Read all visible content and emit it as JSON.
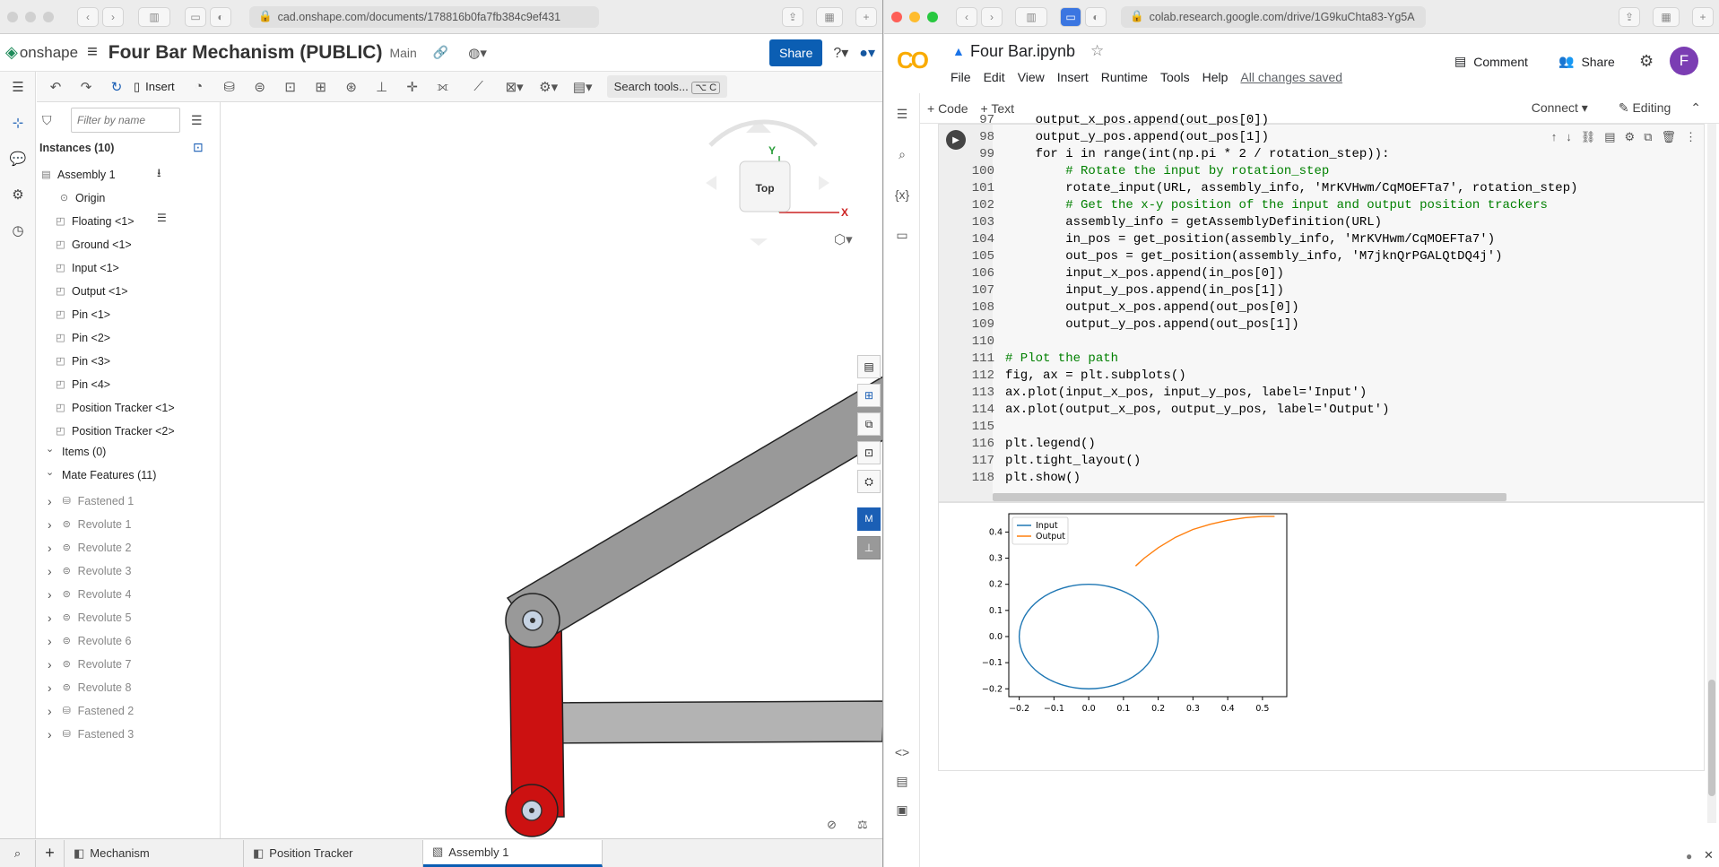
{
  "onshape": {
    "url": "cad.onshape.com/documents/178816b0fa7fb384c9ef431",
    "logo": "onshape",
    "doc_title": "Four Bar Mechanism (PUBLIC)",
    "branch": "Main",
    "share_label": "Share",
    "insert_label": "Insert",
    "search_tools": "Search tools...",
    "search_shortcut": "⌥ C",
    "filter_placeholder": "Filter by name",
    "instances_header": "Instances (10)",
    "tree": [
      "Assembly 1",
      "Origin",
      "Floating <1>",
      "Ground <1>",
      "Input <1>",
      "Output <1>",
      "Pin <1>",
      "Pin <2>",
      "Pin <3>",
      "Pin <4>",
      "Position Tracker <1>",
      "Position Tracker <2>"
    ],
    "items_header": "Items (0)",
    "mate_header": "Mate Features (11)",
    "mates": [
      "Fastened 1",
      "Revolute 1",
      "Revolute 2",
      "Revolute 3",
      "Revolute 4",
      "Revolute 5",
      "Revolute 6",
      "Revolute 7",
      "Revolute 8",
      "Fastened 2",
      "Fastened 3"
    ],
    "view_cube": "Top",
    "axis_x": "X",
    "axis_y": "Y",
    "tabs": [
      "Mechanism",
      "Position Tracker",
      "Assembly 1"
    ],
    "colors": {
      "brand": "#0b5eb3",
      "ground": "#b3b3b3",
      "input": "#cc1111",
      "coupler": "#999999",
      "output": "#3a60b0"
    }
  },
  "colab": {
    "url": "colab.research.google.com/drive/1G9kuChta83-Yg5A",
    "logo": "CO",
    "title": "Four Bar.ipynb",
    "menus": [
      "File",
      "Edit",
      "View",
      "Insert",
      "Runtime",
      "Tools",
      "Help"
    ],
    "saved": "All changes saved",
    "comment": "Comment",
    "share": "Share",
    "avatar": "F",
    "code_btn": "+ Code",
    "text_btn": "+ Text",
    "connect": "Connect",
    "editing": "Editing",
    "code": [
      {
        "n": "97",
        "t": "    output_x_pos.append(out_pos[0])"
      },
      {
        "n": "98",
        "t": "    output_y_pos.append(out_pos[1])"
      },
      {
        "n": "99",
        "t": "    for i in range(int(np.pi * 2 / rotation_step)):"
      },
      {
        "n": "100",
        "t": "        # Rotate the input by rotation_step"
      },
      {
        "n": "101",
        "t": "        rotate_input(URL, assembly_info, 'MrKVHwm/CqMOEFTa7', rotation_step)"
      },
      {
        "n": "102",
        "t": "        # Get the x-y position of the input and output position trackers"
      },
      {
        "n": "103",
        "t": "        assembly_info = getAssemblyDefinition(URL)"
      },
      {
        "n": "104",
        "t": "        in_pos = get_position(assembly_info, 'MrKVHwm/CqMOEFTa7')"
      },
      {
        "n": "105",
        "t": "        out_pos = get_position(assembly_info, 'M7jknQrPGALQtDQ4j')"
      },
      {
        "n": "106",
        "t": "        input_x_pos.append(in_pos[0])"
      },
      {
        "n": "107",
        "t": "        input_y_pos.append(in_pos[1])"
      },
      {
        "n": "108",
        "t": "        output_x_pos.append(out_pos[0])"
      },
      {
        "n": "109",
        "t": "        output_y_pos.append(out_pos[1])"
      },
      {
        "n": "110",
        "t": ""
      },
      {
        "n": "111",
        "t": "# Plot the path"
      },
      {
        "n": "112",
        "t": "fig, ax = plt.subplots()"
      },
      {
        "n": "113",
        "t": "ax.plot(input_x_pos, input_y_pos, label='Input')"
      },
      {
        "n": "114",
        "t": "ax.plot(output_x_pos, output_y_pos, label='Output')"
      },
      {
        "n": "115",
        "t": ""
      },
      {
        "n": "116",
        "t": "plt.legend()"
      },
      {
        "n": "117",
        "t": "plt.tight_layout()"
      },
      {
        "n": "118",
        "t": "plt.show()"
      }
    ]
  },
  "chart_data": {
    "type": "line",
    "title": "",
    "xlabel": "",
    "ylabel": "",
    "xlim": [
      -0.23,
      0.57
    ],
    "ylim": [
      -0.23,
      0.47
    ],
    "xticks": [
      "−0.2",
      "−0.1",
      "0.0",
      "0.1",
      "0.2",
      "0.3",
      "0.4",
      "0.5"
    ],
    "xtick_vals": [
      -0.2,
      -0.1,
      0,
      0.1,
      0.2,
      0.3,
      0.4,
      0.5
    ],
    "yticks": [
      "−0.2",
      "−0.1",
      "0.0",
      "0.1",
      "0.2",
      "0.3",
      "0.4"
    ],
    "ytick_vals": [
      -0.2,
      -0.1,
      0,
      0.1,
      0.2,
      0.3,
      0.4
    ],
    "legend": "top-left",
    "grid": false,
    "series": [
      {
        "name": "Input",
        "color": "#1f77b4",
        "x": [
          0.2,
          0.173,
          0.1,
          0,
          -0.1,
          -0.173,
          -0.2,
          -0.173,
          -0.1,
          0,
          0.1,
          0.173,
          0.2
        ],
        "y": [
          0,
          0.1,
          0.173,
          0.2,
          0.173,
          0.1,
          0,
          -0.1,
          -0.173,
          -0.2,
          -0.173,
          -0.1,
          0
        ]
      },
      {
        "name": "Output",
        "color": "#ff7f0e",
        "x": [
          0.135,
          0.16,
          0.2,
          0.25,
          0.3,
          0.35,
          0.4,
          0.45,
          0.5,
          0.535
        ],
        "y": [
          0.27,
          0.3,
          0.34,
          0.38,
          0.41,
          0.43,
          0.445,
          0.455,
          0.46,
          0.46
        ]
      }
    ]
  }
}
